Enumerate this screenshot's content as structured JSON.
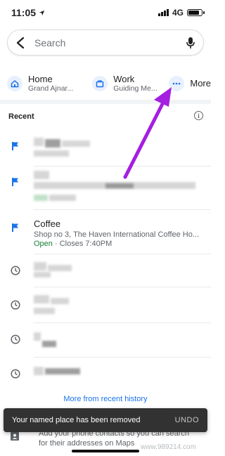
{
  "status_bar": {
    "time": "11:05",
    "network": "4G",
    "battery_level": 0.85
  },
  "search": {
    "placeholder": "Search"
  },
  "shortcuts": [
    {
      "title": "Home",
      "subtitle": "Grand Ajnar..."
    },
    {
      "title": "Work",
      "subtitle": "Guiding Me..."
    },
    {
      "title": "More",
      "subtitle": ""
    }
  ],
  "recent": {
    "header": "Recent",
    "coffee": {
      "title": "Coffee",
      "address": "Shop no 3, The Haven International Coffee Ho...",
      "open": "Open",
      "closes": "· Closes 7:40PM"
    },
    "more_link": "More from recent history"
  },
  "contacts_promo": {
    "text_line1": "Add your phone contacts so you can search",
    "text_line2": "for their addresses on Maps"
  },
  "snackbar": {
    "message": "Your named place has been removed",
    "action": "UNDO"
  },
  "watermark": "www.989214.com",
  "colors": {
    "accent_blue": "#1a73e8",
    "open_green": "#188038",
    "annotation_arrow": "#a51fe0"
  }
}
